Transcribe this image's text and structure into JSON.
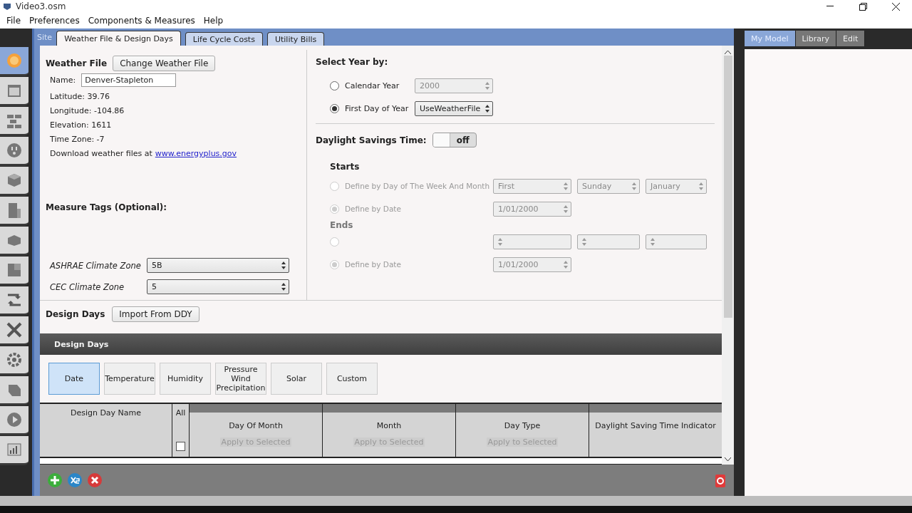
{
  "window": {
    "title": "Video3.osm"
  },
  "menu": [
    "File",
    "Preferences",
    "Components & Measures",
    "Help"
  ],
  "sidebar_items": [
    {
      "kind": "sun",
      "selected": true
    },
    {
      "kind": "calendar",
      "selected": false
    },
    {
      "kind": "bricks",
      "selected": false
    },
    {
      "kind": "outlet",
      "selected": false
    },
    {
      "kind": "cube",
      "selected": false
    },
    {
      "kind": "building",
      "selected": false
    },
    {
      "kind": "box",
      "selected": false
    },
    {
      "kind": "boxes",
      "selected": false
    },
    {
      "kind": "loop",
      "selected": false
    },
    {
      "kind": "tools",
      "selected": false
    },
    {
      "kind": "gear",
      "selected": false
    },
    {
      "kind": "sheet",
      "selected": false
    },
    {
      "kind": "play",
      "selected": false
    },
    {
      "kind": "chart",
      "selected": false
    }
  ],
  "section_label": "Site",
  "tabs": [
    {
      "label": "Weather File & Design Days",
      "selected": true
    },
    {
      "label": "Life Cycle Costs",
      "selected": false
    },
    {
      "label": "Utility Bills",
      "selected": false
    }
  ],
  "weather": {
    "title": "Weather File",
    "button": "Change Weather File",
    "name_label": "Name:",
    "name_value": "Denver-Stapleton",
    "info": [
      "Latitude: 39.76",
      "Longitude: -104.86",
      "Elevation: 1611",
      "Time Zone: -7"
    ],
    "download_text": "Download weather files at",
    "download_link": "www.energyplus.gov"
  },
  "measure_tags": {
    "title": "Measure Tags (Optional):",
    "fields": [
      {
        "label": "ASHRAE Climate Zone",
        "value": "5B"
      },
      {
        "label": "CEC Climate Zone",
        "value": "5"
      }
    ]
  },
  "year": {
    "title": "Select Year by:",
    "options": [
      {
        "label": "Calendar Year",
        "selected": false,
        "value": "2000"
      },
      {
        "label": "First Day of Year",
        "selected": true,
        "value": "UseWeatherFile"
      }
    ]
  },
  "dst": {
    "label": "Daylight Savings Time:",
    "on": false,
    "state_text": "off",
    "starts": {
      "title": "Starts",
      "options": [
        {
          "kind": "week",
          "label": "Define by Day of The Week And Month",
          "selected": false,
          "values": [
            "First",
            "Sunday",
            "January"
          ]
        },
        {
          "kind": "date",
          "label": "Define by Date",
          "selected": true,
          "values": [
            "1/01/2000"
          ]
        }
      ]
    },
    "ends": {
      "title": "Ends",
      "options": [
        {
          "kind": "covered",
          "selected": false
        },
        {
          "kind": "date",
          "label": "Define by Date",
          "selected": true,
          "values": [
            "1/01/2000"
          ]
        }
      ]
    }
  },
  "design_days": {
    "title": "Design Days",
    "button": "Import From DDY",
    "bar_title": "Design Days",
    "subtabs": [
      {
        "label": "Date",
        "selected": true
      },
      {
        "label": "Temperature",
        "selected": false
      },
      {
        "label": "Humidity",
        "selected": false
      },
      {
        "label": "Pressure\nWind\nPrecipitation",
        "selected": false
      },
      {
        "label": "Solar",
        "selected": false
      },
      {
        "label": "Custom",
        "selected": false
      }
    ],
    "name_column": "Design Day Name",
    "all_label": "All",
    "all_checked": false,
    "columns": [
      {
        "title": "Day Of Month",
        "apply": "Apply to Selected"
      },
      {
        "title": "Month",
        "apply": "Apply to Selected"
      },
      {
        "title": "Day Type",
        "apply": "Apply to Selected"
      },
      {
        "title": "Daylight Saving Time Indicator"
      }
    ]
  },
  "right_tabs": [
    {
      "label": "My Model",
      "selected": true
    },
    {
      "label": "Library",
      "selected": false
    },
    {
      "label": "Edit",
      "selected": false
    }
  ]
}
